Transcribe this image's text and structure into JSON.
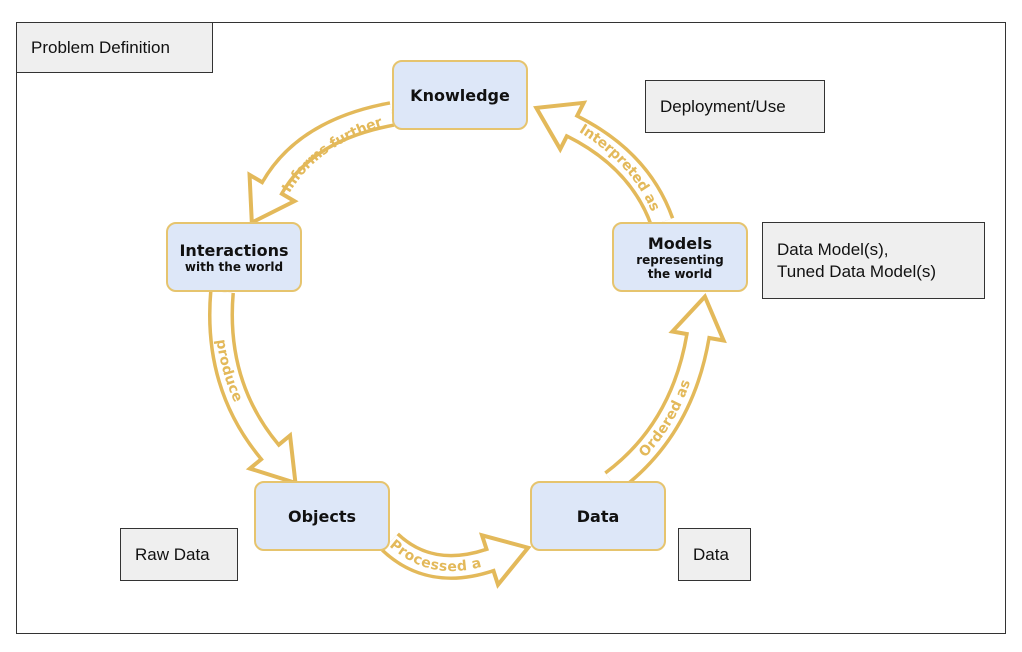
{
  "annotations": {
    "problem_definition": "Problem Definition",
    "deployment": "Deployment/Use",
    "data_models_line1": "Data Model(s),",
    "data_models_line2": "Tuned Data Model(s)",
    "raw_data": "Raw Data",
    "data": "Data"
  },
  "nodes": {
    "knowledge": {
      "title": "Knowledge"
    },
    "interactions": {
      "title": "Interactions",
      "subtitle": "with the world"
    },
    "models": {
      "title": "Models",
      "subtitle_line1": "representing",
      "subtitle_line2": "the world"
    },
    "objects": {
      "title": "Objects"
    },
    "data": {
      "title": "Data"
    }
  },
  "arrows": {
    "informs": "Informs further",
    "produce": "produce",
    "processed": "Processed as",
    "ordered": "Ordered as",
    "interpreted": "Interpreted as"
  },
  "colors": {
    "arrow": "#e3b95a",
    "node_fill": "#dde7f8",
    "tag_fill": "#efefef"
  }
}
